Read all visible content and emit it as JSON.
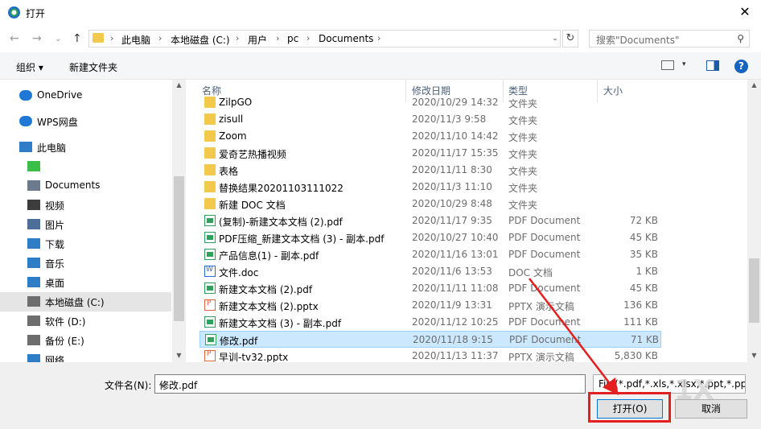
{
  "window": {
    "title": "打开",
    "close_symbol": "✕"
  },
  "nav": {
    "back": "←",
    "forward": "→",
    "recent": "⌄",
    "up": "↑"
  },
  "address": {
    "crumbs": [
      "此电脑",
      "本地磁盘 (C:)",
      "用户",
      "pc",
      "Documents"
    ],
    "separator": "›",
    "dropdown": "⌄",
    "refresh": "↻"
  },
  "search": {
    "placeholder": "搜索\"Documents\"",
    "icon": "⚲"
  },
  "toolbar": {
    "organize": "组织 ▾",
    "new_folder": "新建文件夹",
    "view_drop": "▾",
    "help": "?"
  },
  "sidebar": {
    "items": [
      {
        "label": "OneDrive",
        "icon": "cloud-icon"
      },
      {
        "label": "WPS网盘",
        "icon": "cloud-icon"
      },
      {
        "label": "此电脑",
        "icon": "computer-icon"
      },
      {
        "label": "",
        "icon": "app-icon"
      },
      {
        "label": "Documents",
        "icon": "document-icon"
      },
      {
        "label": "视频",
        "icon": "video-icon"
      },
      {
        "label": "图片",
        "icon": "picture-icon"
      },
      {
        "label": "下载",
        "icon": "download-icon"
      },
      {
        "label": "音乐",
        "icon": "music-icon"
      },
      {
        "label": "桌面",
        "icon": "desktop-icon"
      },
      {
        "label": "本地磁盘 (C:)",
        "icon": "drive-icon",
        "selected": true
      },
      {
        "label": "软件 (D:)",
        "icon": "drive-icon"
      },
      {
        "label": "备份 (E:)",
        "icon": "drive-icon"
      },
      {
        "label": "网络",
        "icon": "network-icon"
      }
    ]
  },
  "columns": {
    "name": "名称",
    "date": "修改日期",
    "type": "类型",
    "size": "大小",
    "sort_indicator": "^"
  },
  "files": [
    {
      "name": "ZilpGO",
      "date": "2020/10/29 14:32",
      "type": "文件夹",
      "size": "",
      "kind": "folder"
    },
    {
      "name": "zisull",
      "date": "2020/11/3 9:58",
      "type": "文件夹",
      "size": "",
      "kind": "folder"
    },
    {
      "name": "Zoom",
      "date": "2020/11/10 14:42",
      "type": "文件夹",
      "size": "",
      "kind": "folder"
    },
    {
      "name": "爱奇艺热播视频",
      "date": "2020/11/17 15:35",
      "type": "文件夹",
      "size": "",
      "kind": "folder"
    },
    {
      "name": "表格",
      "date": "2020/11/11 8:30",
      "type": "文件夹",
      "size": "",
      "kind": "folder"
    },
    {
      "name": "替换结果20201103111022",
      "date": "2020/11/3 11:10",
      "type": "文件夹",
      "size": "",
      "kind": "folder"
    },
    {
      "name": "新建 DOC 文档",
      "date": "2020/10/29 8:48",
      "type": "文件夹",
      "size": "",
      "kind": "folder"
    },
    {
      "name": "(复制)-新建文本文档 (2).pdf",
      "date": "2020/11/17 9:35",
      "type": "PDF Document",
      "size": "72 KB",
      "kind": "pdf"
    },
    {
      "name": "PDF压缩_新建文本文档 (3) - 副本.pdf",
      "date": "2020/10/27 10:40",
      "type": "PDF Document",
      "size": "45 KB",
      "kind": "pdf"
    },
    {
      "name": "产品信息(1) - 副本.pdf",
      "date": "2020/11/16 13:01",
      "type": "PDF Document",
      "size": "35 KB",
      "kind": "pdf"
    },
    {
      "name": "文件.doc",
      "date": "2020/11/6 13:53",
      "type": "DOC 文档",
      "size": "1 KB",
      "kind": "doc"
    },
    {
      "name": "新建文本文档 (2).pdf",
      "date": "2020/11/11 11:08",
      "type": "PDF Document",
      "size": "45 KB",
      "kind": "pdf"
    },
    {
      "name": "新建文本文档 (2).pptx",
      "date": "2020/11/9 13:31",
      "type": "PPTX 演示文稿",
      "size": "136 KB",
      "kind": "pptx"
    },
    {
      "name": "新建文本文档 (3) - 副本.pdf",
      "date": "2020/11/12 10:25",
      "type": "PDF Document",
      "size": "111 KB",
      "kind": "pdf"
    },
    {
      "name": "修改.pdf",
      "date": "2020/11/18 9:15",
      "type": "PDF Document",
      "size": "71 KB",
      "kind": "pdf",
      "selected": true
    },
    {
      "name": "早训-tv32.pptx",
      "date": "2020/11/13 11:37",
      "type": "PPTX 演示文稿",
      "size": "5,830 KB",
      "kind": "pptx"
    }
  ],
  "bottom": {
    "filename_label": "文件名(N):",
    "filename_value": "修改.pdf",
    "filter": "File(*.pdf,*.xls,*.xlsx,*.ppt,*.pp",
    "dropdown": "⌄",
    "open_button": "打开(O)",
    "cancel_button": "取消"
  },
  "scroll": {
    "up": "▲",
    "down": "▼"
  },
  "watermark": "1X",
  "colors": {
    "selection": "#cce8ff",
    "accent": "#0078d7",
    "annotation": "#e41f1f"
  }
}
